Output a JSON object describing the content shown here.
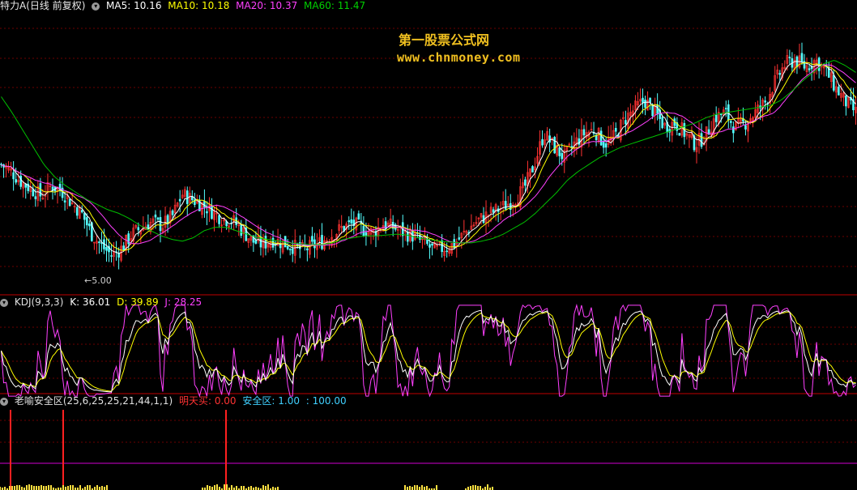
{
  "main_header": {
    "title": "特力A(日线 前复权)",
    "ma5": "MA5: 10.16",
    "ma10": "MA10: 10.18",
    "ma20": "MA20: 10.37",
    "ma60": "MA60: 11.47"
  },
  "watermark": {
    "line1": "第一股票公式网",
    "line2": "www.chnmoney.com"
  },
  "low_marker": "5.00",
  "kdj_header": {
    "name": "KDJ(9,3,3)",
    "k": "K: 36.01",
    "d": "D: 39.89",
    "j": "J: 28.25"
  },
  "safe_header": {
    "name": "老喻安全区(25,6,25,25,21,44,1,1)",
    "buy": "明天买: 0.00",
    "zone": "安全区: 1.00",
    "val": ": 100.00"
  },
  "colors": {
    "up": "#ff3232",
    "down": "#54ffff",
    "ma5": "#ffffff",
    "ma10": "#ffff00",
    "ma20": "#ff40ff",
    "ma60": "#00c000",
    "k": "#ffffff",
    "d": "#ffff00",
    "j": "#ff40ff",
    "grid": "#6b0000",
    "divider": "#c00000"
  },
  "chart_data": {
    "type": "candlestick",
    "price_anchor": {
      "low_label": 5.0
    },
    "close_path": [
      11.6,
      11.2,
      10.6,
      10.2,
      9.8,
      10.4,
      10.1,
      9.4,
      8.8,
      7.6,
      6.9,
      6.4,
      6.8,
      7.6,
      8.0,
      8.3,
      8.1,
      8.6,
      9.9,
      9.6,
      9.3,
      8.9,
      8.5,
      8.4,
      7.8,
      7.2,
      7.0,
      7.3,
      7.1,
      6.9,
      6.7,
      6.9,
      7.2,
      7.6,
      8.0,
      8.2,
      7.9,
      7.7,
      8.2,
      8.0,
      7.7,
      7.5,
      7.1,
      6.7,
      6.8,
      7.0,
      7.6,
      8.2,
      8.6,
      8.9,
      9.2,
      9.6,
      10.2,
      11.6,
      13.4,
      12.6,
      12.0,
      12.8,
      13.4,
      13.6,
      12.8,
      13.2,
      14.2,
      14.8,
      15.3,
      14.6,
      13.8,
      14.0,
      13.4,
      12.8,
      13.2,
      14.3,
      14.6,
      13.7,
      14.0,
      14.6,
      15.2,
      16.4,
      17.4,
      17.6,
      17.2,
      17.6,
      17.0,
      16.0,
      15.2,
      14.6
    ],
    "ma60_path": [
      15.5,
      14.6,
      13.6,
      12.6,
      11.6,
      10.9,
      10.4,
      10.0,
      9.6,
      9.3,
      9.0,
      8.8,
      8.5,
      8.1,
      7.8,
      7.5,
      7.3,
      7.2,
      7.4,
      7.8,
      8.0,
      8.0,
      7.8,
      7.6,
      7.4,
      7.3,
      7.2,
      7.1,
      7.05,
      7.0,
      7.0,
      7.1,
      7.3,
      7.4,
      7.5,
      7.5,
      7.55,
      7.6,
      7.55,
      7.4,
      7.3,
      7.2,
      7.15,
      7.1,
      7.1,
      7.2,
      7.35,
      7.6,
      7.95,
      8.3,
      8.8,
      9.4,
      10.0,
      10.7,
      11.2,
      11.6,
      12.0,
      12.3,
      12.6,
      12.8,
      13.0,
      13.2,
      13.4,
      13.6,
      13.8,
      14.0,
      14.3,
      14.5,
      14.6,
      14.7,
      14.8,
      14.9,
      15.0,
      15.3,
      15.8,
      16.4,
      16.9,
      17.4,
      17.6,
      17.3,
      16.9
    ],
    "kdj": {
      "k": 36.01,
      "d": 39.89,
      "j": 28.25,
      "ylim": [
        0,
        100
      ]
    },
    "safe_zone": {
      "buy": 0.0,
      "zone": 1.0,
      "val": 100.0,
      "signal_bars_x": [
        13,
        78,
        279
      ]
    }
  }
}
